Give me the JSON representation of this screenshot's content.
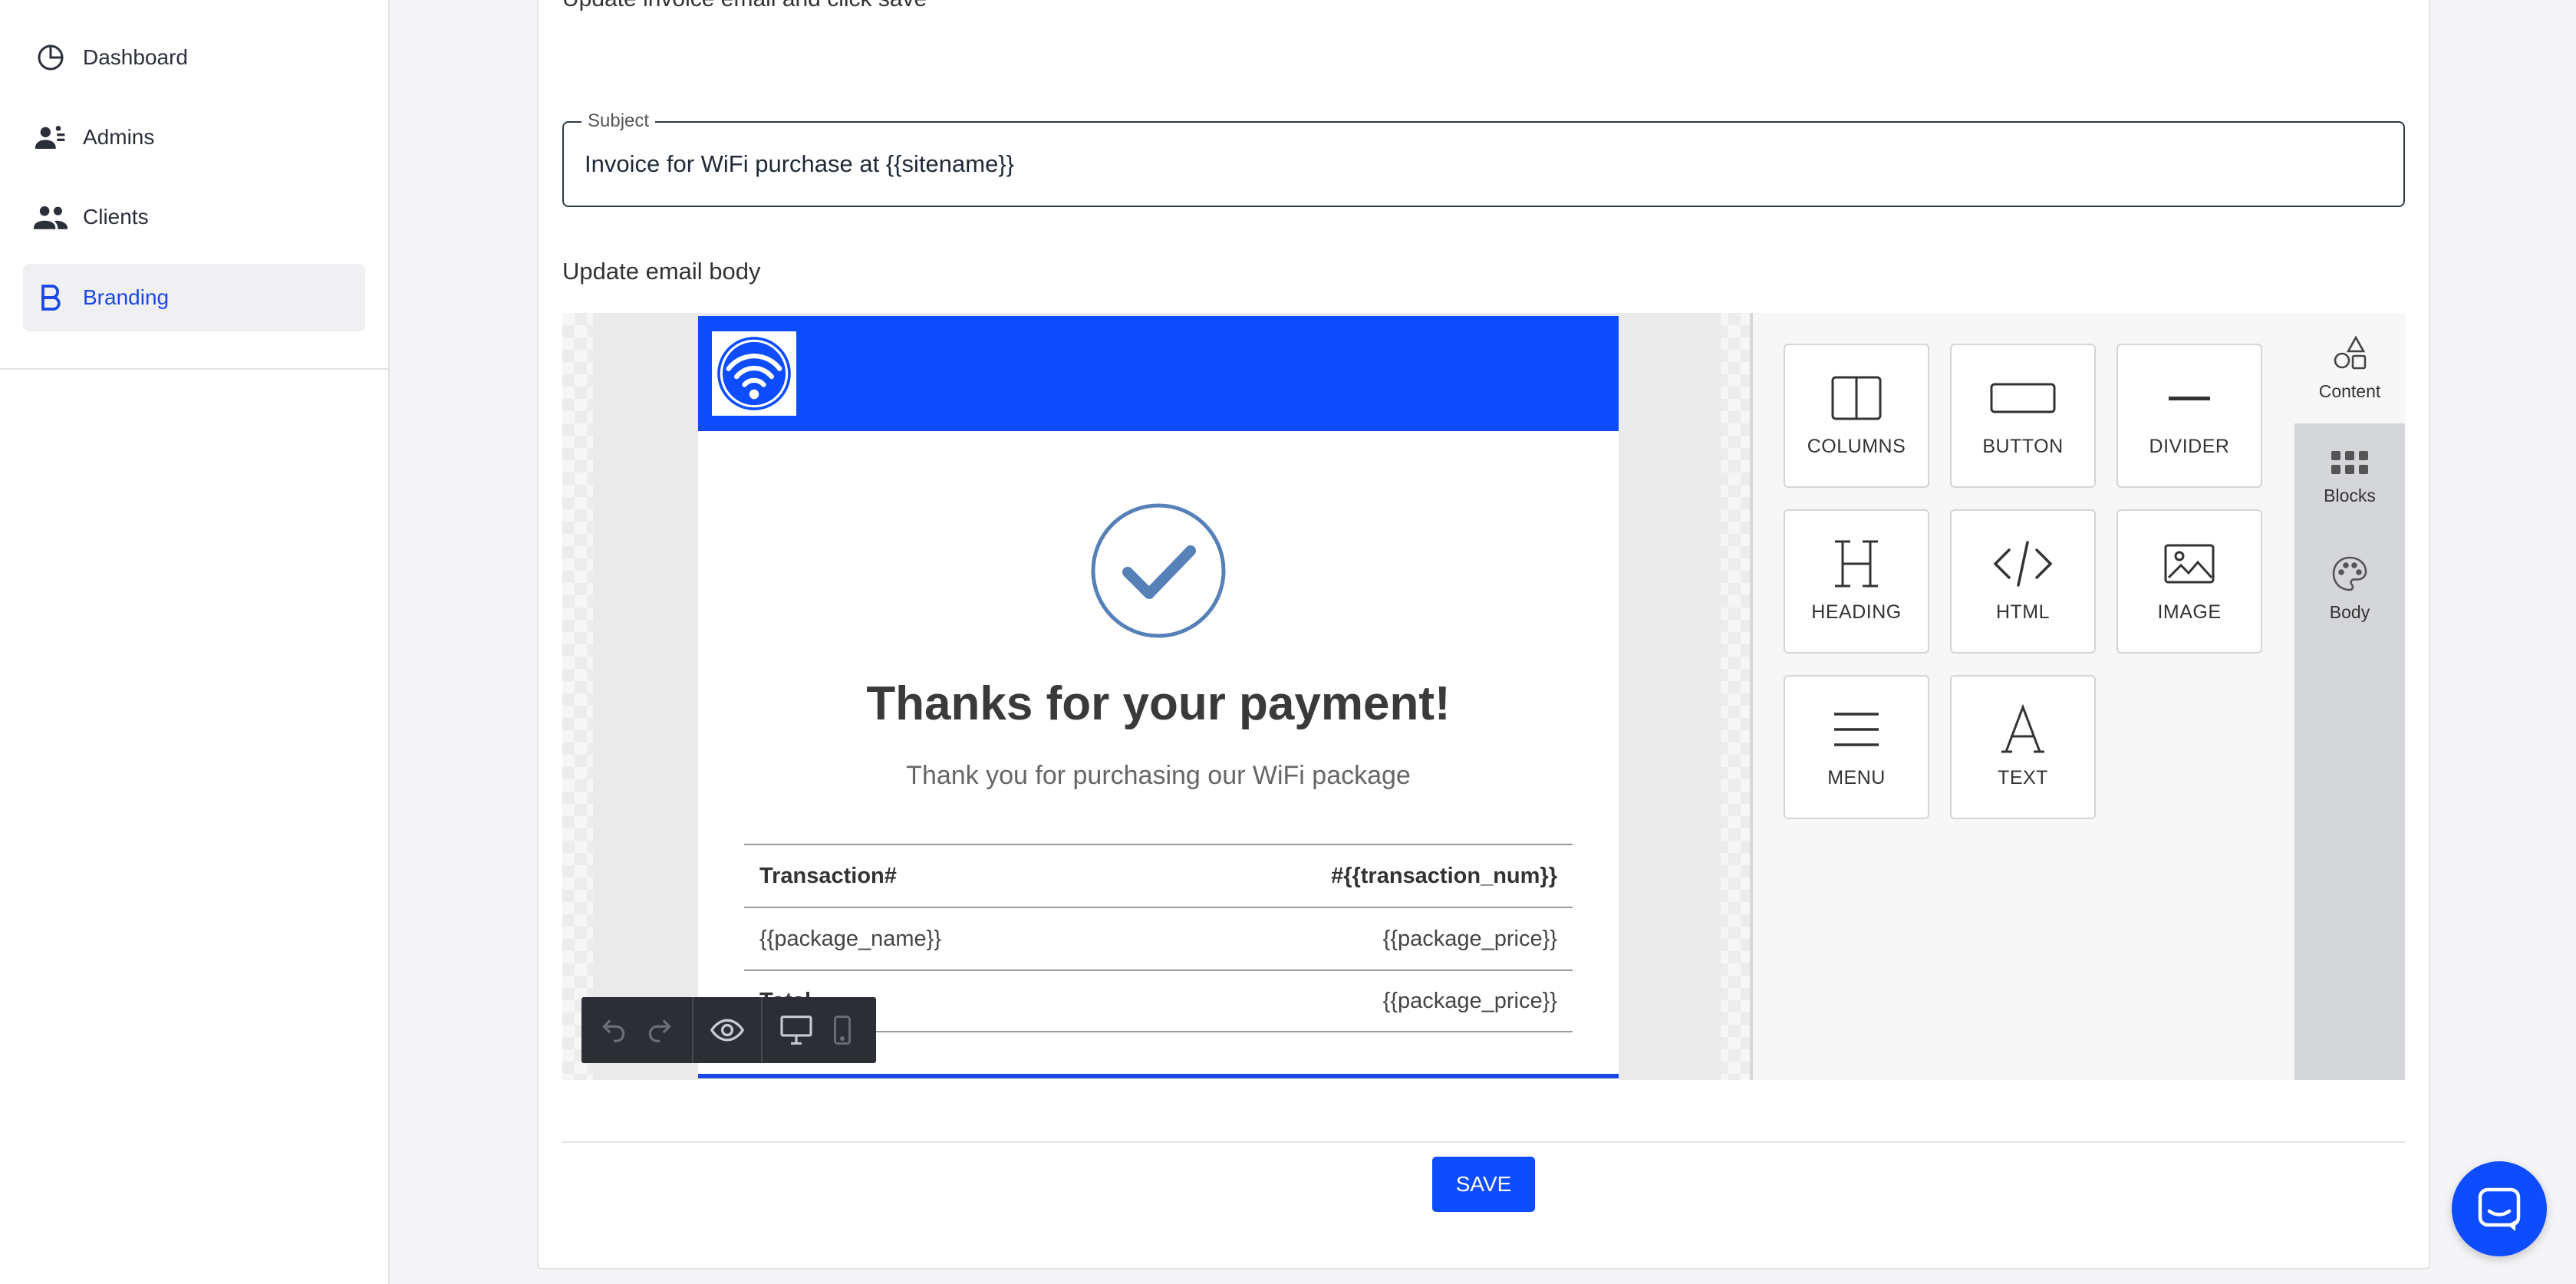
{
  "sidebar": {
    "items": [
      {
        "label": "Dashboard",
        "icon": "pie-chart-icon"
      },
      {
        "label": "Admins",
        "icon": "admins-icon"
      },
      {
        "label": "Clients",
        "icon": "clients-icon"
      },
      {
        "label": "Branding",
        "icon": "branding-icon",
        "active": true
      }
    ]
  },
  "main": {
    "instruction": "Update invoice email and click save",
    "subject": {
      "legend": "Subject",
      "value": "Invoice for WiFi purchase at {{sitename}}"
    },
    "body_label": "Update email body"
  },
  "email": {
    "title": "Thanks for your payment!",
    "subtitle": "Thank you for purchasing our WiFi package",
    "rows": [
      {
        "left": "Transaction#",
        "right": "#{{transaction_num}}"
      },
      {
        "left": "{{package_name}}",
        "right": "{{package_price}}"
      },
      {
        "left": "Total",
        "right": "{{package_price}}"
      }
    ]
  },
  "tools": [
    {
      "label": "COLUMNS",
      "icon": "columns-icon"
    },
    {
      "label": "BUTTON",
      "icon": "button-icon"
    },
    {
      "label": "DIVIDER",
      "icon": "divider-icon"
    },
    {
      "label": "HEADING",
      "icon": "heading-icon"
    },
    {
      "label": "HTML",
      "icon": "html-code-icon"
    },
    {
      "label": "IMAGE",
      "icon": "image-icon"
    },
    {
      "label": "MENU",
      "icon": "menu-icon"
    },
    {
      "label": "TEXT",
      "icon": "text-icon"
    }
  ],
  "tabs": [
    {
      "label": "Content",
      "icon": "shapes-icon",
      "active": true
    },
    {
      "label": "Blocks",
      "icon": "grid-icon"
    },
    {
      "label": "Body",
      "icon": "palette-icon"
    }
  ],
  "actions": {
    "save_label": "SAVE"
  },
  "colors": {
    "accent": "#0d4dff",
    "active_nav": "#1a47e6",
    "check": "#5580b8"
  }
}
